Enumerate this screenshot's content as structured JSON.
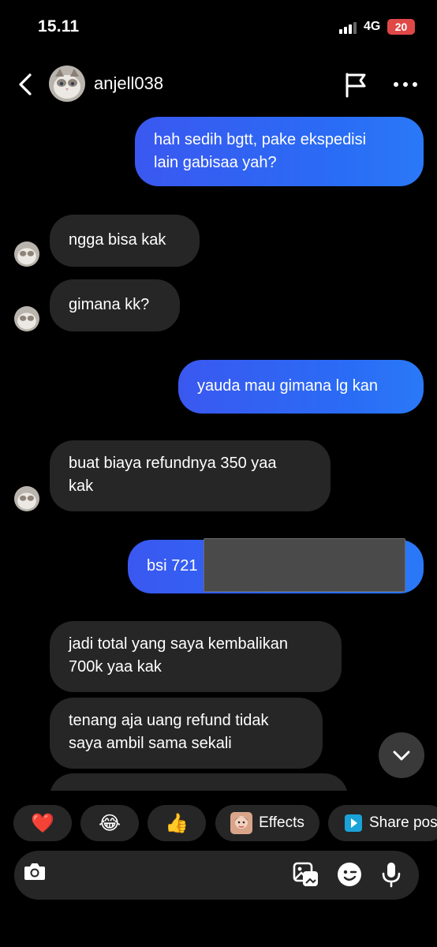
{
  "status_bar": {
    "time": "15.11",
    "network": "4G",
    "battery": "20"
  },
  "header": {
    "username": "anjell038"
  },
  "messages": [
    {
      "text_1": "hah sedih bgtt, pake ekspedisi",
      "text_2": "lain gabisaa yah?"
    },
    {
      "text_1": "ngga bisa kak"
    },
    {
      "text_1": "gimana kk?"
    },
    {
      "text_1": "yauda mau gimana lg kan"
    },
    {
      "text_1": "buat biaya refundnya 350 yaa",
      "text_2": "kak"
    },
    {
      "text_1": "bsi 721"
    },
    {
      "text_1": "jadi total yang saya kembalikan",
      "text_2": "700k yaa kak"
    },
    {
      "text_1": "tenang aja uang refund tidak",
      "text_2": "saya ambil sama sekali"
    }
  ],
  "reactions": [
    {
      "icon": "heart-icon",
      "emoji": "❤️"
    },
    {
      "icon": "laugh-cry-icon",
      "emoji": "😂"
    },
    {
      "icon": "thumbs-up-icon",
      "emoji": "👍"
    },
    {
      "icon": "effects-icon",
      "label": "Effects"
    },
    {
      "icon": "share-icon",
      "label": "Share pos"
    }
  ],
  "colors": {
    "outgoing": "#3a5cf3",
    "incoming": "#262626",
    "background": "#000000"
  }
}
